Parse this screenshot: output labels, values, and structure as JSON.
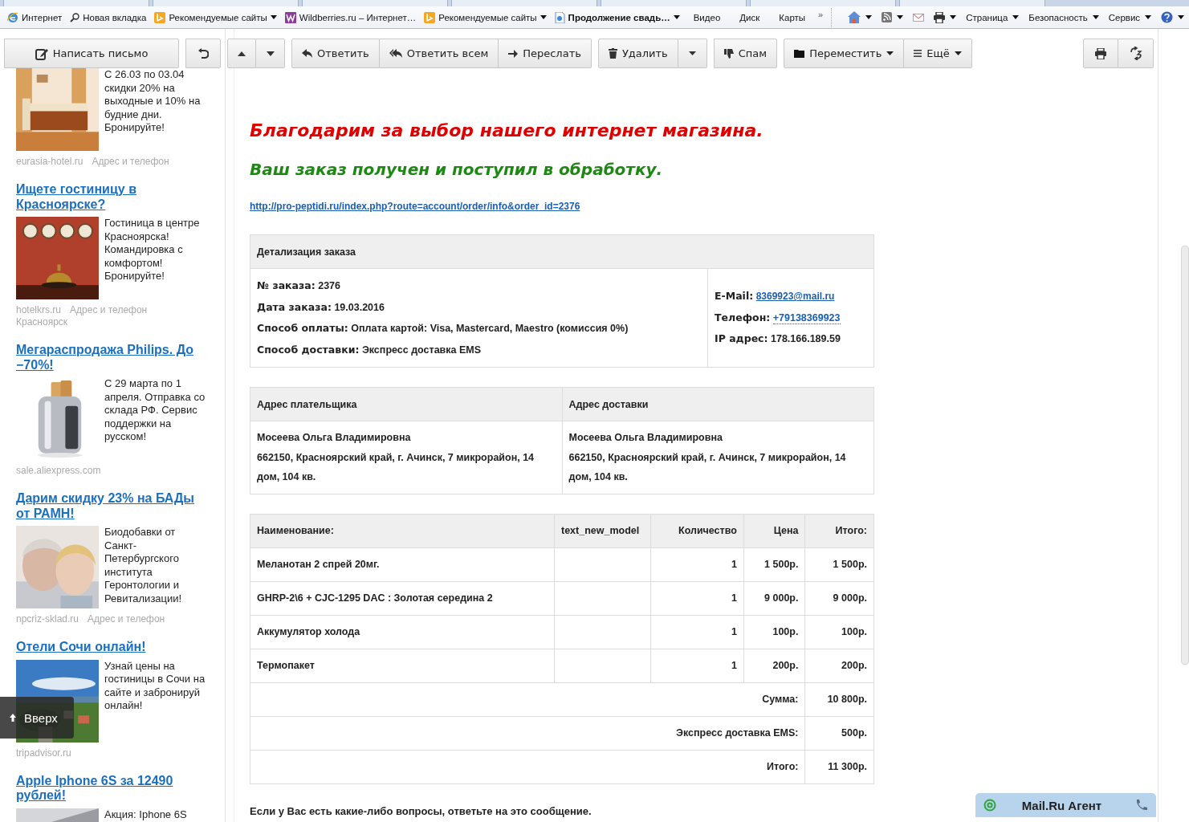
{
  "browser": {
    "favorites": [
      {
        "label": "Интернет",
        "dropdown": false,
        "bold": false
      },
      {
        "label": "Новая вкладка",
        "dropdown": false,
        "bold": false
      },
      {
        "label": "Рекомендуемые сайты",
        "dropdown": true,
        "bold": false
      },
      {
        "label": "Wildberries.ru – Интернет…",
        "dropdown": false,
        "bold": false
      },
      {
        "label": "Рекомендуемые сайты",
        "dropdown": true,
        "bold": false
      },
      {
        "label": "Продолжение свадь…",
        "dropdown": true,
        "bold": true
      },
      {
        "label": "Видео",
        "dropdown": false,
        "bold": false
      },
      {
        "label": "Диск",
        "dropdown": false,
        "bold": false
      },
      {
        "label": "Карты",
        "dropdown": false,
        "bold": false
      }
    ],
    "more": "»",
    "commands": [
      {
        "dropdown": true
      },
      {
        "dropdown": true
      },
      {
        "dropdown": false
      },
      {
        "dropdown": true
      },
      {
        "label": "Страница",
        "dropdown": true
      },
      {
        "label": "Безопасность",
        "dropdown": true
      },
      {
        "label": "Сервис",
        "dropdown": true
      },
      {
        "dropdown": true
      }
    ]
  },
  "toolbar": {
    "left_groups": [
      {
        "buttons": [
          {
            "label": "Написать письмо",
            "dropdown": false
          }
        ]
      },
      {
        "buttons": [
          {
            "dropdown": false
          }
        ]
      },
      {
        "buttons": [
          {
            "dropdown": false
          },
          {
            "dropdown": false
          }
        ]
      },
      {
        "buttons": [
          {
            "label": "Ответить",
            "dropdown": false
          },
          {
            "label": "Ответить всем",
            "dropdown": false
          },
          {
            "label": "Переслать",
            "dropdown": false
          }
        ]
      },
      {
        "buttons": [
          {
            "label": "Удалить",
            "dropdown": false
          },
          {
            "dropdown": false
          }
        ]
      },
      {
        "buttons": [
          {
            "label": "Спам",
            "dropdown": false
          }
        ]
      },
      {
        "buttons": [
          {
            "label": "Переместить",
            "dropdown": true
          },
          {
            "label": "Ещё",
            "dropdown": true
          }
        ]
      }
    ],
    "right_groups": [
      {
        "buttons": [
          {
            "dropdown": false
          },
          {
            "dropdown": false
          }
        ]
      }
    ]
  },
  "sidebar": {
    "ads": [
      {
        "text": "С 26.03 по 03.04 скидки 20% на выходные и 10% на будние дни. Бронируйте!",
        "source": "eurasia-hotel.ru",
        "contact": "Адрес и телефон",
        "kind": "picture"
      },
      {
        "title": "Ищете гостиницу в Красноярске?",
        "text": "Гостиница в центре Красноярска! Командировка с комфортом! Бронируйте!",
        "source": "hotelkrs.ru",
        "contact": "Адрес и телефон",
        "city": "Красноярск",
        "kind": "picture"
      },
      {
        "title": "Мегараспродажа Philips. До −70%!",
        "text": "С 29 марта по 1 апреля. Отправка со склада РФ. Сервис поддержки на русском!",
        "source": "sale.aliexpress.com",
        "kind": "picture"
      },
      {
        "title": "Дарим скидку 23% на БАДы от РАМН!",
        "text": "Биодобавки от Санкт-Петербургского института Геронтологии и Ревитализации!",
        "source": "npcriz-sklad.ru",
        "contact": "Адрес и телефон",
        "kind": "picture"
      },
      {
        "title": "Отели Сочи онлайн!",
        "text": "Узнай цены на гостиницы в Сочи на сайте и забронируй онлайн!",
        "source": "tripadvisor.ru",
        "kind": "picture"
      },
      {
        "title": "Apple Iphone 6S за 12490 рублей!",
        "text": "Акция: Iphone 6S",
        "kind": "picture"
      }
    ]
  },
  "scroll_up": {
    "label": "Вверх"
  },
  "letter": {
    "heading": "Благодарим за выбор нашего интернет магазина.",
    "subheading": "Ваш заказ получен и поступил в обработку.",
    "link": "http://pro-peptidi.ru/index.php?route=account/order/info&order_id=2376",
    "order_details": {
      "title": "Детализация заказа",
      "left": [
        {
          "label": "№ заказа:",
          "value": "2376",
          "kind": "text"
        },
        {
          "label": "Дата заказа:",
          "value": "19.03.2016",
          "kind": "text"
        },
        {
          "label": "Способ оплаты:",
          "value": "Оплата картой: Visa, Mastercard, Maestro (комиссия 0%)",
          "kind": "text"
        },
        {
          "label": "Способ доставки:",
          "value": "Экспресс доставка EMS",
          "kind": "text"
        }
      ],
      "right": [
        {
          "label": "E-Mail:",
          "value": "8369923@mail.ru",
          "kind": "link"
        },
        {
          "label": "Телефон:",
          "value": "+79138369923",
          "kind": "phone"
        },
        {
          "label": "IP адрес:",
          "value": "178.166.189.59",
          "kind": "text"
        }
      ]
    },
    "addresses": {
      "columns": [
        "Адрес плательщика",
        "Адрес доставки"
      ],
      "cells": [
        {
          "name": "Мосеева Ольга Владимировна",
          "address": "662150, Красноярский край, г. Ачинск, 7 микрорайон, 14 дом, 104 кв."
        },
        {
          "name": "Мосеева Ольга Владимировна",
          "address": "662150, Красноярский край, г. Ачинск, 7 микрорайон, 14 дом, 104 кв."
        }
      ]
    },
    "products": {
      "columns": [
        "Наименование:",
        "text_new_model",
        "Количество",
        "Цена",
        "Итого:"
      ],
      "rows": [
        [
          "Меланотан 2 спрей 20мг.",
          "",
          "1",
          "1 500р.",
          "1 500р."
        ],
        [
          "GHRP-2\\6 + CJC-1295 DAC : Золотая середина 2",
          "",
          "1",
          "9 000р.",
          "9 000р."
        ],
        [
          "Аккумулятор холода",
          "",
          "1",
          "100р.",
          "100р."
        ],
        [
          "Термопакет",
          "",
          "1",
          "200р.",
          "200р."
        ]
      ],
      "totals": [
        {
          "label": "Сумма:",
          "value": "10 800р."
        },
        {
          "label": "Экспресс доставка EMS:",
          "value": "500р."
        },
        {
          "label": "Итого:",
          "value": "11 300р."
        }
      ]
    },
    "footer": "Если у Вас есть какие-либо вопросы, ответьте на это сообщение."
  },
  "agent": {
    "label": "Mail.Ru Агент"
  }
}
